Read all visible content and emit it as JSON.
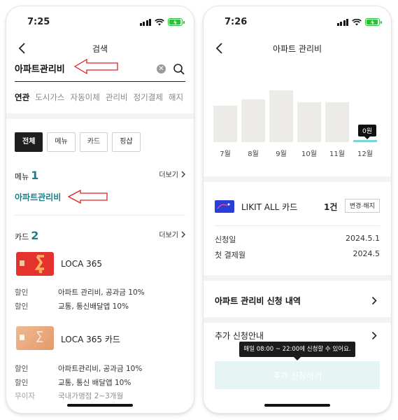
{
  "left_screen": {
    "status_time": "7:25",
    "nav_title": "검색",
    "search": {
      "value": "아파트관리비"
    },
    "tabs": [
      "연관",
      "도시가스",
      "자동이체",
      "관리비",
      "정기결제",
      "해지"
    ],
    "filters": [
      "전체",
      "메뉴",
      "카드",
      "핑샵"
    ],
    "menu_section": {
      "label": "메뉴",
      "count": "1",
      "more": "더보기",
      "result": "아파트관리비"
    },
    "card_section": {
      "label": "카드",
      "count": "2",
      "more": "더보기"
    },
    "cards": [
      {
        "name": "LOCA 365",
        "color": "#e4322d",
        "benefits": [
          {
            "key": "할인",
            "value": "아파트 관리비, 공과금 10%"
          },
          {
            "key": "할인",
            "value": "교통, 통신배달앱 10%"
          }
        ]
      },
      {
        "name": "LOCA 365 카드",
        "color": "#e8a77a",
        "benefits": [
          {
            "key": "할인",
            "value": "아파트관리비, 공과금 10%"
          },
          {
            "key": "할인",
            "value": "교통, 통신 배달앱 10%"
          },
          {
            "key": "무이자",
            "value": "국내가맹점 2~3개월"
          }
        ]
      }
    ]
  },
  "right_screen": {
    "status_time": "7:26",
    "nav_title": "아파트 관리비",
    "chart_data": {
      "type": "bar",
      "categories": [
        "7월",
        "8월",
        "9월",
        "10월",
        "11월",
        "12월"
      ],
      "values": [
        null,
        null,
        null,
        null,
        null,
        0
      ],
      "relative_heights": [
        0.64,
        0.74,
        0.9,
        0.7,
        0.7,
        0.03
      ],
      "highlight_label": "0원",
      "colors": {
        "bar": "#ecebe8",
        "current": "#7fd4d8"
      }
    },
    "card": {
      "name": "LIKIT ALL 카드",
      "count": "1건",
      "action": "변경·해지"
    },
    "info": [
      {
        "label": "신청일",
        "value": "2024.5.1"
      },
      {
        "label": "첫 결제월",
        "value": "2024.5"
      }
    ],
    "menu": [
      {
        "label": "아파트 관리비 신청 내역"
      },
      {
        "label": "추가 신청안내"
      }
    ],
    "tooltip": "매일 08:00 ~ 22:00에 신청할 수 있어요.",
    "apply_button": "추가 신청하기"
  },
  "annotation_color": "#e02020"
}
